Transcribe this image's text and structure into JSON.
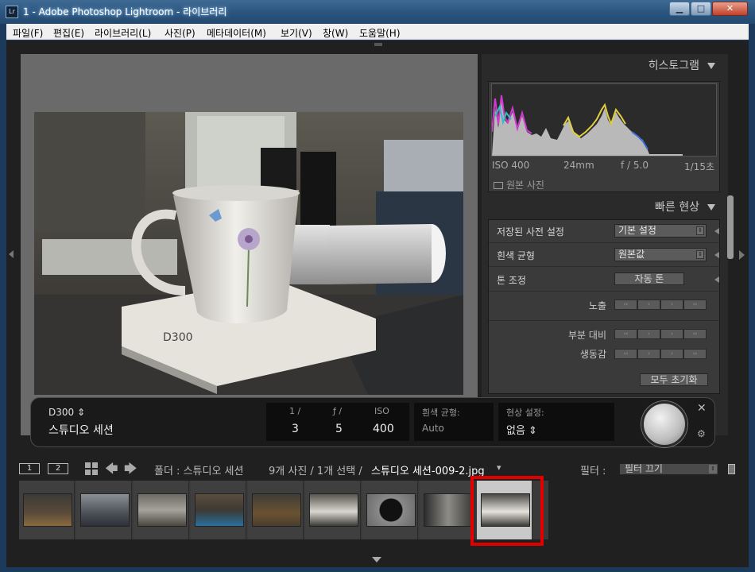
{
  "window": {
    "title": "1 - Adobe Photoshop Lightroom - 라이브러리",
    "app_icon": "Lr",
    "controls": [
      "minimize-icon",
      "maximize-icon",
      "close-icon"
    ]
  },
  "menubar": {
    "items": [
      "파일(F)",
      "편집(E)",
      "라이브러리(L)",
      "사진(P)",
      "메타데이터(M)",
      "보기(V)",
      "창(W)",
      "도움말(H)"
    ]
  },
  "histogram": {
    "title": "히스토그램",
    "iso": "ISO 400",
    "focal": "24mm",
    "aperture": "f / 5.0",
    "shutter": "1/15초",
    "original_photo": "원본 사진"
  },
  "quick_develop": {
    "title": "빠른 현상",
    "saved_preset_label": "저장된 사전 설정",
    "saved_preset_value": "기본 설정",
    "white_balance_label": "흰색 균형",
    "white_balance_value": "원본값",
    "tone_label": "톤 조정",
    "auto_tone": "자동 톤",
    "exposure": "노출",
    "clarity": "부분 대비",
    "vibrance": "생동감",
    "reset_all": "모두 초기화",
    "step_labels": [
      "‹‹",
      "‹",
      "›",
      "››"
    ]
  },
  "hud": {
    "camera": "D300 ⇕",
    "session": "스튜디오 세션",
    "shutter_label": "1 /",
    "shutter_value": "3",
    "aperture_label": "ƒ /",
    "aperture_value": "5",
    "iso_label": "ISO",
    "iso_value": "400",
    "wb_label": "흰색 균형:",
    "wb_value": "Auto",
    "dev_label": "현상 설정:",
    "dev_value": "없음 ⇕"
  },
  "filmstrip_bar": {
    "monitor1": "1",
    "monitor2": "2",
    "folder_label": "폴더 : 스튜디오 세션",
    "count": "9개 사진 / 1개 선택 /",
    "filename": "스튜디오 세션-009-2.jpg",
    "filename_arrow": "▾",
    "filter_label": "필터 :",
    "filter_value": "필터 끄기"
  },
  "filmstrip": {
    "count": 9,
    "selected_index": 8
  },
  "colors": {
    "selection_outline": "#e00000",
    "panel_bg": "#3a3a3a",
    "app_bg": "#202020"
  }
}
